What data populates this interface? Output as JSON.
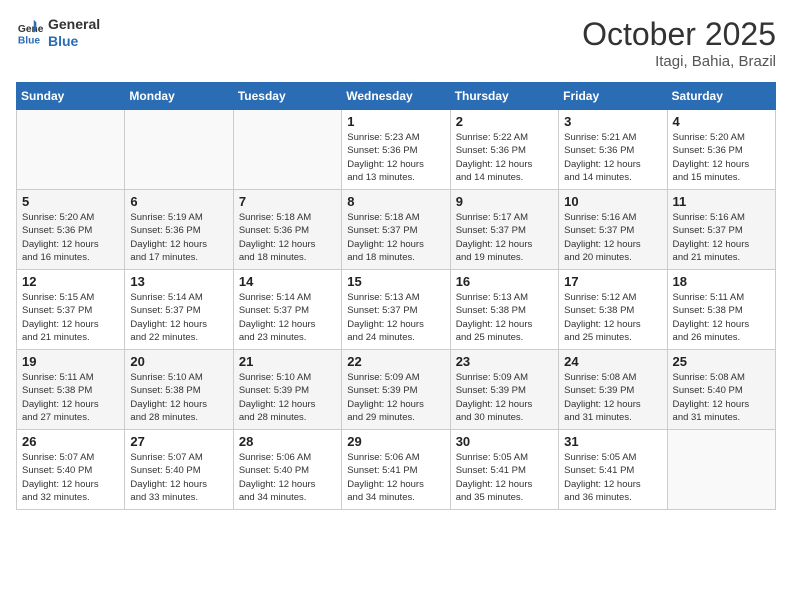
{
  "header": {
    "logo_line1": "General",
    "logo_line2": "Blue",
    "title": "October 2025",
    "subtitle": "Itagi, Bahia, Brazil"
  },
  "days_of_week": [
    "Sunday",
    "Monday",
    "Tuesday",
    "Wednesday",
    "Thursday",
    "Friday",
    "Saturday"
  ],
  "weeks": [
    [
      {
        "day": "",
        "info": ""
      },
      {
        "day": "",
        "info": ""
      },
      {
        "day": "",
        "info": ""
      },
      {
        "day": "1",
        "info": "Sunrise: 5:23 AM\nSunset: 5:36 PM\nDaylight: 12 hours\nand 13 minutes."
      },
      {
        "day": "2",
        "info": "Sunrise: 5:22 AM\nSunset: 5:36 PM\nDaylight: 12 hours\nand 14 minutes."
      },
      {
        "day": "3",
        "info": "Sunrise: 5:21 AM\nSunset: 5:36 PM\nDaylight: 12 hours\nand 14 minutes."
      },
      {
        "day": "4",
        "info": "Sunrise: 5:20 AM\nSunset: 5:36 PM\nDaylight: 12 hours\nand 15 minutes."
      }
    ],
    [
      {
        "day": "5",
        "info": "Sunrise: 5:20 AM\nSunset: 5:36 PM\nDaylight: 12 hours\nand 16 minutes."
      },
      {
        "day": "6",
        "info": "Sunrise: 5:19 AM\nSunset: 5:36 PM\nDaylight: 12 hours\nand 17 minutes."
      },
      {
        "day": "7",
        "info": "Sunrise: 5:18 AM\nSunset: 5:36 PM\nDaylight: 12 hours\nand 18 minutes."
      },
      {
        "day": "8",
        "info": "Sunrise: 5:18 AM\nSunset: 5:37 PM\nDaylight: 12 hours\nand 18 minutes."
      },
      {
        "day": "9",
        "info": "Sunrise: 5:17 AM\nSunset: 5:37 PM\nDaylight: 12 hours\nand 19 minutes."
      },
      {
        "day": "10",
        "info": "Sunrise: 5:16 AM\nSunset: 5:37 PM\nDaylight: 12 hours\nand 20 minutes."
      },
      {
        "day": "11",
        "info": "Sunrise: 5:16 AM\nSunset: 5:37 PM\nDaylight: 12 hours\nand 21 minutes."
      }
    ],
    [
      {
        "day": "12",
        "info": "Sunrise: 5:15 AM\nSunset: 5:37 PM\nDaylight: 12 hours\nand 21 minutes."
      },
      {
        "day": "13",
        "info": "Sunrise: 5:14 AM\nSunset: 5:37 PM\nDaylight: 12 hours\nand 22 minutes."
      },
      {
        "day": "14",
        "info": "Sunrise: 5:14 AM\nSunset: 5:37 PM\nDaylight: 12 hours\nand 23 minutes."
      },
      {
        "day": "15",
        "info": "Sunrise: 5:13 AM\nSunset: 5:37 PM\nDaylight: 12 hours\nand 24 minutes."
      },
      {
        "day": "16",
        "info": "Sunrise: 5:13 AM\nSunset: 5:38 PM\nDaylight: 12 hours\nand 25 minutes."
      },
      {
        "day": "17",
        "info": "Sunrise: 5:12 AM\nSunset: 5:38 PM\nDaylight: 12 hours\nand 25 minutes."
      },
      {
        "day": "18",
        "info": "Sunrise: 5:11 AM\nSunset: 5:38 PM\nDaylight: 12 hours\nand 26 minutes."
      }
    ],
    [
      {
        "day": "19",
        "info": "Sunrise: 5:11 AM\nSunset: 5:38 PM\nDaylight: 12 hours\nand 27 minutes."
      },
      {
        "day": "20",
        "info": "Sunrise: 5:10 AM\nSunset: 5:38 PM\nDaylight: 12 hours\nand 28 minutes."
      },
      {
        "day": "21",
        "info": "Sunrise: 5:10 AM\nSunset: 5:39 PM\nDaylight: 12 hours\nand 28 minutes."
      },
      {
        "day": "22",
        "info": "Sunrise: 5:09 AM\nSunset: 5:39 PM\nDaylight: 12 hours\nand 29 minutes."
      },
      {
        "day": "23",
        "info": "Sunrise: 5:09 AM\nSunset: 5:39 PM\nDaylight: 12 hours\nand 30 minutes."
      },
      {
        "day": "24",
        "info": "Sunrise: 5:08 AM\nSunset: 5:39 PM\nDaylight: 12 hours\nand 31 minutes."
      },
      {
        "day": "25",
        "info": "Sunrise: 5:08 AM\nSunset: 5:40 PM\nDaylight: 12 hours\nand 31 minutes."
      }
    ],
    [
      {
        "day": "26",
        "info": "Sunrise: 5:07 AM\nSunset: 5:40 PM\nDaylight: 12 hours\nand 32 minutes."
      },
      {
        "day": "27",
        "info": "Sunrise: 5:07 AM\nSunset: 5:40 PM\nDaylight: 12 hours\nand 33 minutes."
      },
      {
        "day": "28",
        "info": "Sunrise: 5:06 AM\nSunset: 5:40 PM\nDaylight: 12 hours\nand 34 minutes."
      },
      {
        "day": "29",
        "info": "Sunrise: 5:06 AM\nSunset: 5:41 PM\nDaylight: 12 hours\nand 34 minutes."
      },
      {
        "day": "30",
        "info": "Sunrise: 5:05 AM\nSunset: 5:41 PM\nDaylight: 12 hours\nand 35 minutes."
      },
      {
        "day": "31",
        "info": "Sunrise: 5:05 AM\nSunset: 5:41 PM\nDaylight: 12 hours\nand 36 minutes."
      },
      {
        "day": "",
        "info": ""
      }
    ]
  ]
}
